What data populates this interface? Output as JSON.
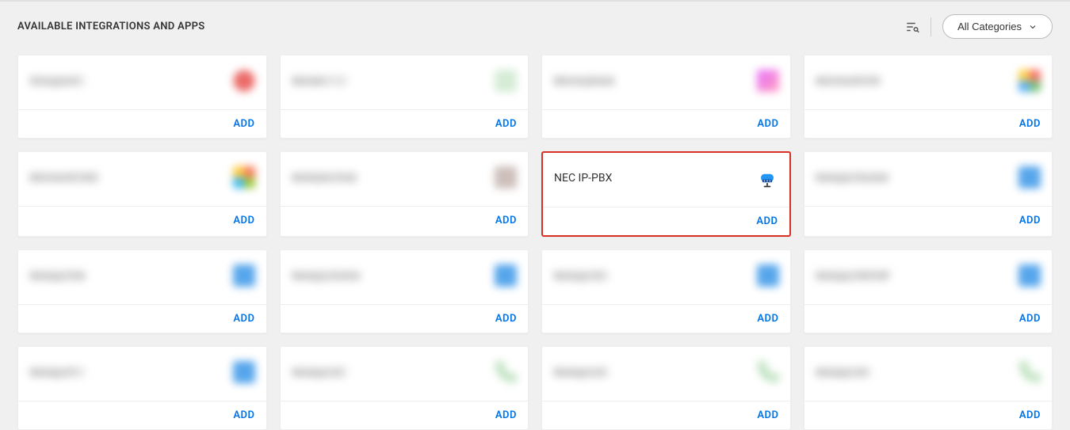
{
  "header": {
    "title": "AVAILABLE INTEGRATIONS AND APPS",
    "categories_label": "All Categories"
  },
  "actions": {
    "add_label": "ADD"
  },
  "cards": [
    {
      "title": "Cloupport",
      "icon": "ic-red",
      "blur": true,
      "highlighted": false
    },
    {
      "title": "Meraki",
      "icon": "ic-green",
      "blur": true,
      "highlighted": false
    },
    {
      "title": "Microsphere",
      "icon": "ic-pink",
      "blur": true,
      "highlighted": false
    },
    {
      "title": "Microsoft HV",
      "icon": "ic-multi",
      "blur": true,
      "highlighted": false
    },
    {
      "title": "Microsoft 365",
      "icon": "ic-win",
      "blur": true,
      "highlighted": false
    },
    {
      "title": "Multiple Cred",
      "icon": "ic-brown",
      "blur": true,
      "highlighted": false
    },
    {
      "title": "NEC IP-PBX",
      "icon": "nec",
      "blur": false,
      "highlighted": true
    },
    {
      "title": "Netapp Cluster",
      "icon": "ic-bluesq",
      "blur": true,
      "highlighted": false
    },
    {
      "title": "Netapp File",
      "icon": "ic-bluesq",
      "blur": true,
      "highlighted": false
    },
    {
      "title": "Netapp Active",
      "icon": "ic-bluesq",
      "blur": true,
      "highlighted": false
    },
    {
      "title": "Netapp IQ",
      "icon": "ic-bluesq",
      "blur": true,
      "highlighted": false
    },
    {
      "title": "Netapp ONTAP",
      "icon": "ic-bluesq",
      "blur": true,
      "highlighted": false
    },
    {
      "title": "Netapp P",
      "icon": "ic-bluesq",
      "blur": true,
      "highlighted": false
    },
    {
      "title": "Netapp x2",
      "icon": "ic-phone",
      "blur": true,
      "highlighted": false
    },
    {
      "title": "Netapp x3",
      "icon": "ic-phone",
      "blur": true,
      "highlighted": false
    },
    {
      "title": "Netapp x4",
      "icon": "ic-phone",
      "blur": true,
      "highlighted": false
    }
  ]
}
